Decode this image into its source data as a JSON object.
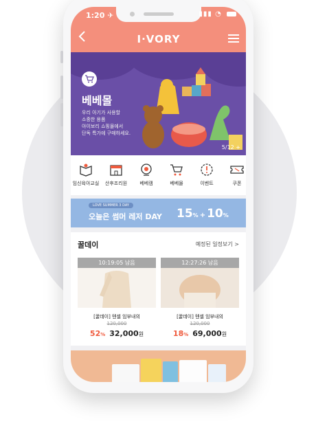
{
  "status": {
    "time": "1:20 ✈"
  },
  "header": {
    "logo": "I·VORY"
  },
  "banner": {
    "title": "베베몰",
    "desc": [
      "우리 아기가 사용할",
      "소중한 용품",
      "아이보리 쇼핑몰에서",
      "단독 특가에 구매하세요."
    ],
    "pager": "5/12  +"
  },
  "categories": [
    {
      "label": "임신육아교실",
      "icon": "book-icon"
    },
    {
      "label": "산후조리원",
      "icon": "building-icon"
    },
    {
      "label": "베베캠",
      "icon": "camera-icon"
    },
    {
      "label": "베베몰",
      "icon": "cart-icon"
    },
    {
      "label": "이벤트",
      "icon": "event-icon"
    },
    {
      "label": "쿠폰",
      "icon": "coupon-icon"
    }
  ],
  "promo": {
    "tag": "LOVE SUMMER 3 DAY",
    "text": "오늘은 썸머 레저 DAY",
    "num1": "15",
    "num2": "10",
    "unit": "%"
  },
  "honey": {
    "title": "꿀데이",
    "more": "예정된 일정보기 >",
    "products": [
      {
        "timer": "10:19:05 남음",
        "name": "[꿀데이] 텐셀 임부내의",
        "orig": "120,000",
        "discount": "52",
        "price": "32,000",
        "won": "원"
      },
      {
        "timer": "12:27:26 남음",
        "name": "[꿀데이] 텐셀 임부내의",
        "orig": "120,000",
        "discount": "18",
        "price": "69,000",
        "won": "원"
      }
    ]
  },
  "colors": {
    "header": "#f48f7c",
    "banner": "#6a4fa7",
    "promo": "#94b7e3",
    "discount": "#ef5a3d"
  }
}
